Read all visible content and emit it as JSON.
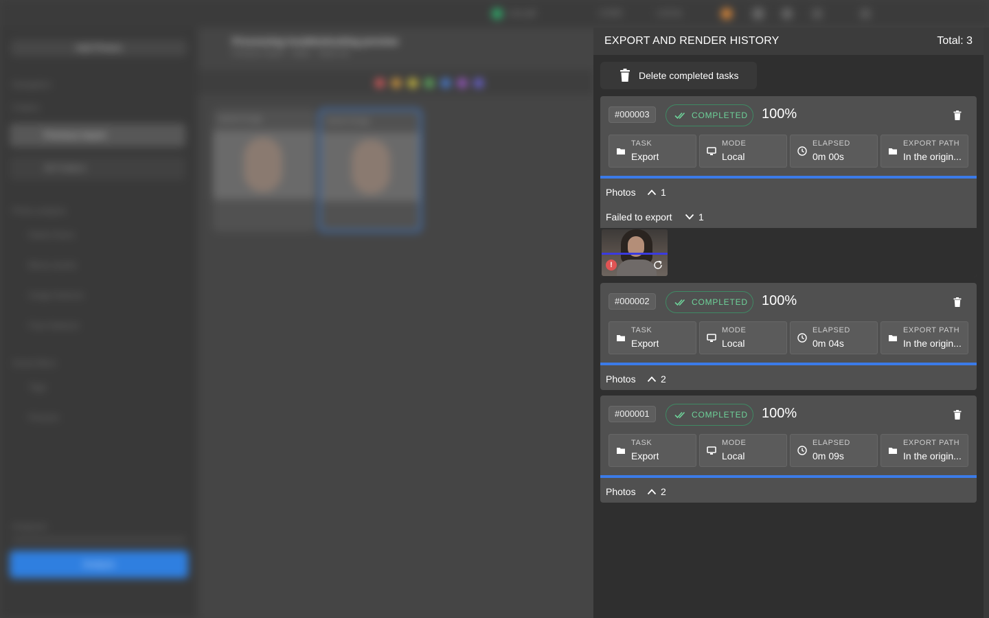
{
  "background": {
    "topbar": {
      "items": [
        "Live pill",
        "CORE",
        "LOCAL"
      ]
    },
    "sidebar": {
      "import_label": "Add Photos",
      "section_label": "Navigation",
      "folders_label": "Folders",
      "rows": [
        "Previous import",
        "All Folders"
      ],
      "section2_label": "Photo analysis",
      "analysis_items": [
        "Detect faces",
        "Blurry assets",
        "Image features",
        "Face features"
      ],
      "section3_label": "Smart filters",
      "filter_items": [
        "Tags",
        "Persons"
      ],
      "analyzed_label": "Analyzed",
      "analyze_button": "Analyze"
    },
    "main": {
      "title": "Processing troubleshooting preview",
      "subtitle": "Previous import · Dates · Select all",
      "cards": [
        "Jasmin-01.jpg",
        "Jasmin-02.jpg"
      ],
      "swatch_colors": [
        "#d45a5a",
        "#d59a3d",
        "#cfc03f",
        "#5fae5f",
        "#4a7ed6",
        "#9b59c9",
        "#6b62d6"
      ]
    }
  },
  "panel": {
    "title": "EXPORT AND RENDER HISTORY",
    "total": "Total: 3",
    "delete_button": "Delete completed tasks",
    "accent_color": "#3b7be8",
    "status_color": "#6ed39a",
    "tasks": [
      {
        "id": "#000003",
        "status": "COMPLETED",
        "percent": "100%",
        "task_key": "TASK",
        "task_val": "Export",
        "mode_key": "MODE",
        "mode_val": "Local",
        "elapsed_key": "ELAPSED",
        "elapsed_val": "0m 00s",
        "path_key": "EXPORT PATH",
        "path_val": "In the origin...",
        "photos_label": "Photos",
        "photos_count": "1",
        "failed_label": "Failed to export",
        "failed_count": "1"
      },
      {
        "id": "#000002",
        "status": "COMPLETED",
        "percent": "100%",
        "task_key": "TASK",
        "task_val": "Export",
        "mode_key": "MODE",
        "mode_val": "Local",
        "elapsed_key": "ELAPSED",
        "elapsed_val": "0m 04s",
        "path_key": "EXPORT PATH",
        "path_val": "In the origin...",
        "photos_label": "Photos",
        "photos_count": "2"
      },
      {
        "id": "#000001",
        "status": "COMPLETED",
        "percent": "100%",
        "task_key": "TASK",
        "task_val": "Export",
        "mode_key": "MODE",
        "mode_val": "Local",
        "elapsed_key": "ELAPSED",
        "elapsed_val": "0m 09s",
        "path_key": "EXPORT PATH",
        "path_val": "In the origin...",
        "photos_label": "Photos",
        "photos_count": "2"
      }
    ]
  }
}
